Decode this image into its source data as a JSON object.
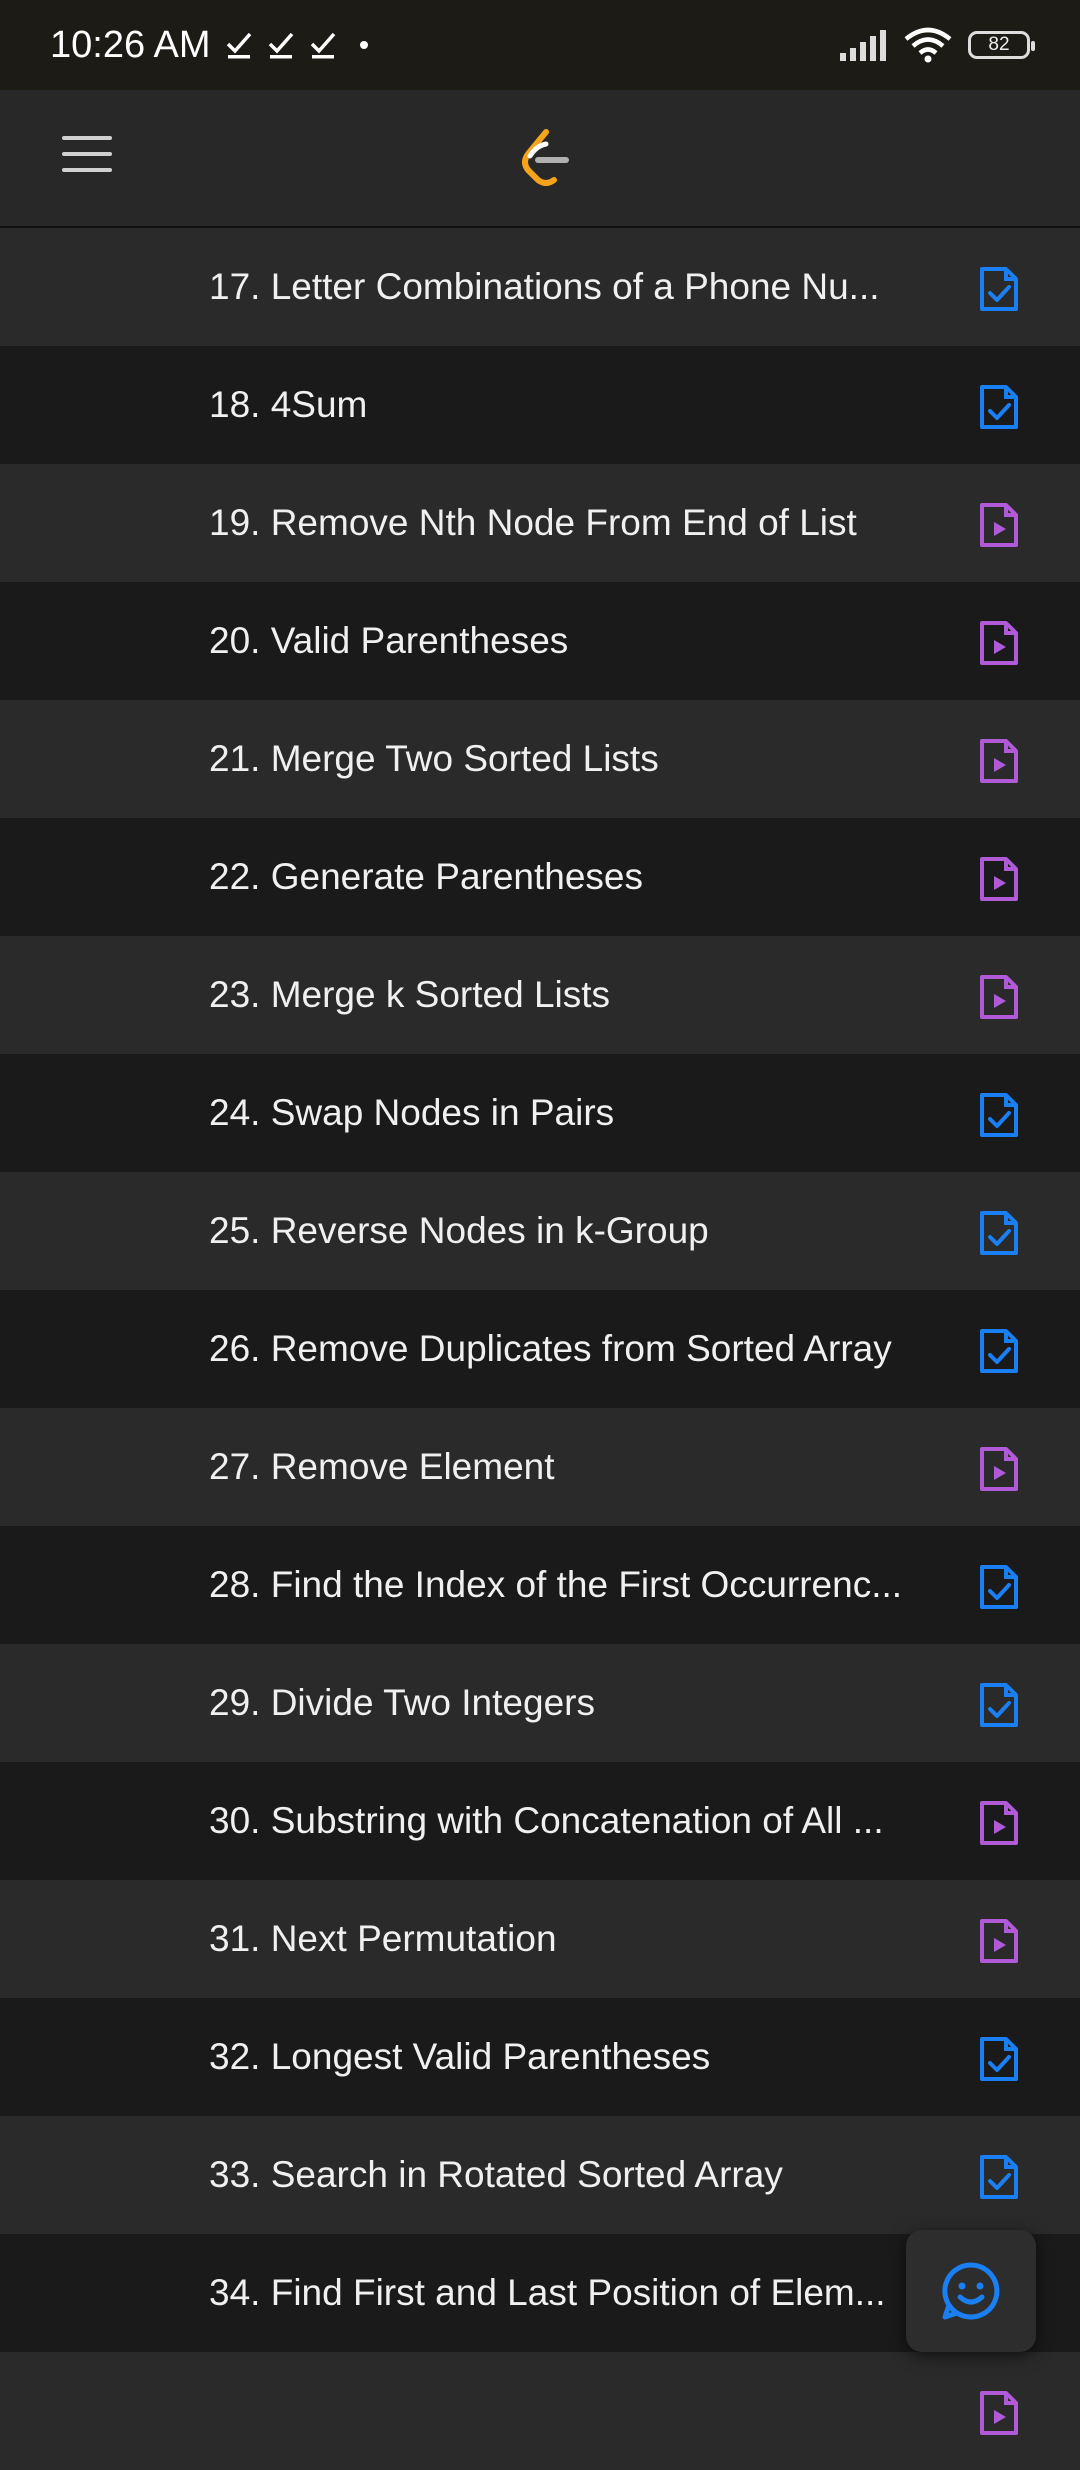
{
  "status_bar": {
    "time": "10:26 AM",
    "battery": "82"
  },
  "colors": {
    "solution_icon": "#1a7ff2",
    "video_icon": "#b05ad7"
  },
  "problems": [
    {
      "title": "17. Letter Combinations of a Phone Nu...",
      "icon": "solution-check-icon"
    },
    {
      "title": "18. 4Sum",
      "icon": "solution-check-icon"
    },
    {
      "title": "19. Remove Nth Node From End of List",
      "icon": "video-solution-icon"
    },
    {
      "title": "20. Valid Parentheses",
      "icon": "video-solution-icon"
    },
    {
      "title": "21. Merge Two Sorted Lists",
      "icon": "video-solution-icon"
    },
    {
      "title": "22. Generate Parentheses",
      "icon": "video-solution-icon"
    },
    {
      "title": "23. Merge k Sorted Lists",
      "icon": "video-solution-icon"
    },
    {
      "title": "24. Swap Nodes in Pairs",
      "icon": "solution-check-icon"
    },
    {
      "title": "25. Reverse Nodes in k-Group",
      "icon": "solution-check-icon"
    },
    {
      "title": "26. Remove Duplicates from Sorted Array",
      "icon": "solution-check-icon"
    },
    {
      "title": "27. Remove Element",
      "icon": "video-solution-icon"
    },
    {
      "title": "28. Find the Index of the First Occurrenc...",
      "icon": "solution-check-icon"
    },
    {
      "title": "29. Divide Two Integers",
      "icon": "solution-check-icon"
    },
    {
      "title": "30. Substring with Concatenation of All ...",
      "icon": "video-solution-icon"
    },
    {
      "title": "31. Next Permutation",
      "icon": "video-solution-icon"
    },
    {
      "title": "32. Longest Valid Parentheses",
      "icon": "solution-check-icon"
    },
    {
      "title": "33. Search in Rotated Sorted Array",
      "icon": "solution-check-icon"
    },
    {
      "title": "34. Find First and Last Position of Elem...",
      "icon": ""
    },
    {
      "title": "",
      "icon": "video-solution-icon"
    }
  ]
}
